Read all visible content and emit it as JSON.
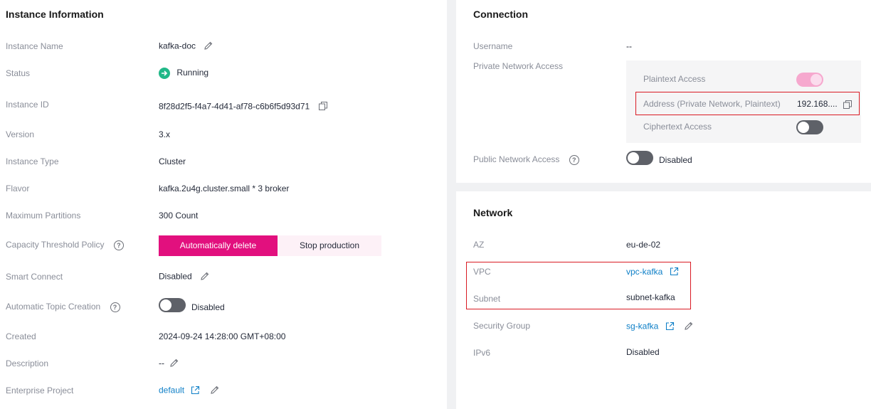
{
  "instance": {
    "title": "Instance Information",
    "name_label": "Instance Name",
    "name_value": "kafka-doc",
    "status_label": "Status",
    "status_value": "Running",
    "id_label": "Instance ID",
    "id_value": "8f28d2f5-f4a7-4d41-af78-c6b6f5d93d71",
    "version_label": "Version",
    "version_value": "3.x",
    "type_label": "Instance Type",
    "type_value": "Cluster",
    "flavor_label": "Flavor",
    "flavor_value": "kafka.2u4g.cluster.small * 3 broker",
    "max_partitions_label": "Maximum Partitions",
    "max_partitions_value": "300 Count",
    "capacity_label": "Capacity Threshold Policy",
    "capacity_options": [
      "Automatically delete",
      "Stop production"
    ],
    "capacity_selected": "Automatically delete",
    "smart_connect_label": "Smart Connect",
    "smart_connect_value": "Disabled",
    "auto_topic_label": "Automatic Topic Creation",
    "auto_topic_value": "Disabled",
    "created_label": "Created",
    "created_value": "2024-09-24 14:28:00 GMT+08:00",
    "description_label": "Description",
    "description_value": "--",
    "enterprise_label": "Enterprise Project",
    "enterprise_value": "default"
  },
  "connection": {
    "title": "Connection",
    "username_label": "Username",
    "username_value": "--",
    "private_label": "Private Network Access",
    "plaintext_label": "Plaintext Access",
    "address_label": "Address (Private Network, Plaintext)",
    "address_value": "192.168....",
    "ciphertext_label": "Ciphertext Access",
    "public_label": "Public Network Access",
    "public_value": "Disabled"
  },
  "network": {
    "title": "Network",
    "az_label": "AZ",
    "az_value": "eu-de-02",
    "vpc_label": "VPC",
    "vpc_value": "vpc-kafka",
    "subnet_label": "Subnet",
    "subnet_value": "subnet-kafka",
    "sg_label": "Security Group",
    "sg_value": "sg-kafka",
    "ipv6_label": "IPv6",
    "ipv6_value": "Disabled"
  },
  "colors": {
    "accent": "#e2107e",
    "link": "#0e7fc7",
    "running": "#21b888",
    "highlight": "#d91b24"
  },
  "icons": [
    "edit-icon",
    "copy-icon",
    "external-link-icon",
    "help-icon",
    "running-status-icon"
  ]
}
